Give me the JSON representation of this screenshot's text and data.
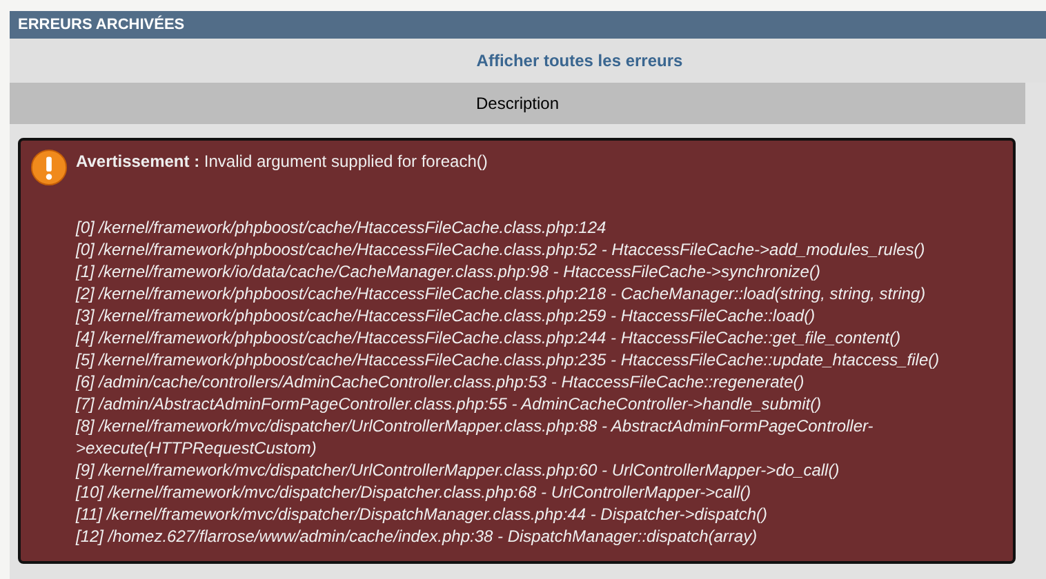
{
  "panel": {
    "title": "ERREURS ARCHIVÉES",
    "link": "Afficher toutes les erreurs"
  },
  "table": {
    "columns": [
      "Description"
    ],
    "error": {
      "message": "**Avertissement :** Invalid argument supplied for foreach()",
      "trace": [
        "[0] /kernel/framework/phpboost/cache/HtaccessFileCache.class.php:124",
        "[0] /kernel/framework/phpboost/cache/HtaccessFileCache.class.php:52 - HtaccessFileCache->add_modules_rules()",
        "[1] /kernel/framework/io/data/cache/CacheManager.class.php:98 - HtaccessFileCache->synchronize()",
        "[2] /kernel/framework/phpboost/cache/HtaccessFileCache.class.php:218 - CacheManager::load(string, string, string)",
        "[3] /kernel/framework/phpboost/cache/HtaccessFileCache.class.php:259 - HtaccessFileCache::load()",
        "[4] /kernel/framework/phpboost/cache/HtaccessFileCache.class.php:244 - HtaccessFileCache::get_file_content()",
        "[5] /kernel/framework/phpboost/cache/HtaccessFileCache.class.php:235 - HtaccessFileCache::update_htaccess_file()",
        "[6] /admin/cache/controllers/AdminCacheController.class.php:53 - HtaccessFileCache::regenerate()",
        "[7] /admin/AbstractAdminFormPageController.class.php:55 - AdminCacheController->handle_submit()",
        "[8] /kernel/framework/mvc/dispatcher/UrlControllerMapper.class.php:88 - AbstractAdminFormPageController->execute(HTTPRequestCustom)",
        "[9] /kernel/framework/mvc/dispatcher/UrlControllerMapper.class.php:60 - UrlControllerMapper->do_call()",
        "[10] /kernel/framework/mvc/dispatcher/Dispatcher.class.php:68 - UrlControllerMapper->call()",
        "[11] /kernel/framework/mvc/dispatcher/DispatchManager.class.php:44 - Dispatcher->dispatch()",
        "[12] /homez.627/flarrose/www/admin/cache/index.php:38 - DispatchManager::dispatch(array)"
      ]
    }
  }
}
